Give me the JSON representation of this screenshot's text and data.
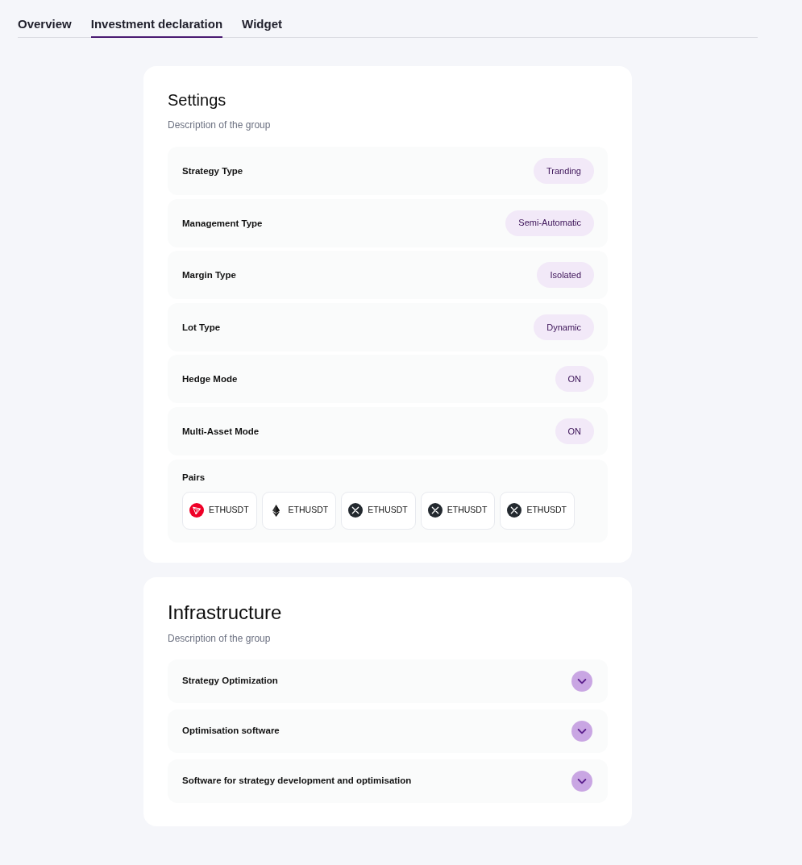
{
  "tabs": [
    {
      "label": "Overview",
      "selected": false
    },
    {
      "label": "Investment declaration",
      "selected": true
    },
    {
      "label": "Widget",
      "selected": false
    }
  ],
  "settings": {
    "title": "Settings",
    "description": "Description of the group",
    "rows": [
      {
        "label": "Strategy Type",
        "value": "Tranding"
      },
      {
        "label": "Management Type",
        "value": "Semi-Automatic"
      },
      {
        "label": "Margin Type",
        "value": "Isolated"
      },
      {
        "label": "Lot Type",
        "value": "Dynamic"
      },
      {
        "label": "Hedge Mode",
        "value": "ON"
      },
      {
        "label": "Multi-Asset Mode",
        "value": "ON"
      }
    ],
    "pairs": {
      "label": "Pairs",
      "items": [
        {
          "kind": "triangle",
          "symbol": "ETHUSDT"
        },
        {
          "kind": "diamond",
          "symbol": "ETHUSDT"
        },
        {
          "kind": "cross",
          "symbol": "ETHUSDT"
        },
        {
          "kind": "cross",
          "symbol": "ETHUSDT"
        },
        {
          "kind": "cross",
          "symbol": "ETHUSDT"
        }
      ]
    }
  },
  "infrastructure": {
    "title": "Infrastructure",
    "description": "Description of the group",
    "items": [
      {
        "label": "Strategy Optimization",
        "expanded": false
      },
      {
        "label": "Optimisation software",
        "expanded": false
      },
      {
        "label": "Software for strategy development and optimisation",
        "expanded": false
      }
    ]
  }
}
